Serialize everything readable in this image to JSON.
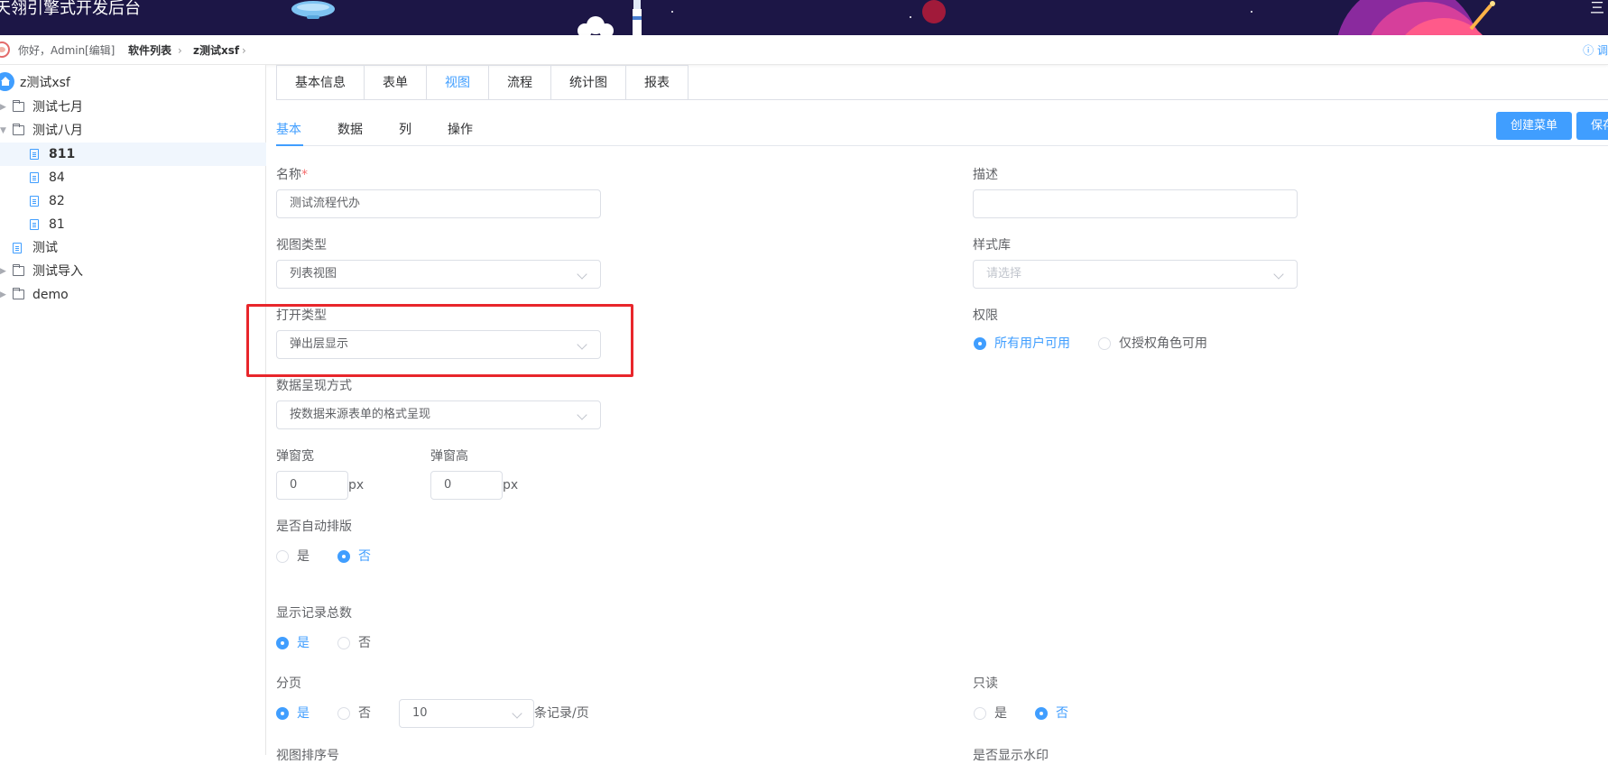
{
  "banner": {
    "title": "天翎引擎式开发后台",
    "menu_glyph": "三"
  },
  "breadcrumb": {
    "greeting": "你好，Admin",
    "edit": "[编辑]",
    "software_list": "软件列表",
    "current": "z测试xsf",
    "right_link": "ⓘ 调"
  },
  "tree": {
    "root": "z测试xsf",
    "items": [
      {
        "label": "测试七月"
      },
      {
        "label": "测试八月"
      },
      {
        "label": "811"
      },
      {
        "label": "84"
      },
      {
        "label": "82"
      },
      {
        "label": "81"
      },
      {
        "label": "测试"
      },
      {
        "label": "测试导入"
      },
      {
        "label": "demo"
      }
    ]
  },
  "tabs": [
    "基本信息",
    "表单",
    "视图",
    "流程",
    "统计图",
    "报表"
  ],
  "subtabs": [
    "基本",
    "数据",
    "列",
    "操作"
  ],
  "buttons": {
    "create_menu": "创建菜单",
    "save": "保存"
  },
  "form": {
    "name_label": "名称",
    "name_required": "*",
    "name_value": "测试流程代办",
    "desc_label": "描述",
    "desc_value": "",
    "view_type_label": "视图类型",
    "view_type_value": "列表视图",
    "style_lib_label": "样式库",
    "style_lib_placeholder": "请选择",
    "open_type_label": "打开类型",
    "open_type_value": "弹出层显示",
    "permission_label": "权限",
    "permission_all": "所有用户可用",
    "permission_role": "仅授权角色可用",
    "data_display_label": "数据呈现方式",
    "data_display_value": "按数据来源表单的格式呈现",
    "popup_width_label": "弹窗宽",
    "popup_width_value": "0",
    "popup_height_label": "弹窗高",
    "popup_height_value": "0",
    "unit_px": "px",
    "auto_layout_label": "是否自动排版",
    "yes": "是",
    "no": "否",
    "show_total_label": "显示记录总数",
    "paging_label": "分页",
    "page_size_value": "10",
    "page_size_unit": "条记录/页",
    "readonly_label": "只读",
    "view_sort_label": "视图排序号",
    "show_watermark_label": "是否显示水印"
  },
  "colors": {
    "accent": "#409eff",
    "banner_bg": "#1c1646",
    "highlight": "#e8262b"
  }
}
